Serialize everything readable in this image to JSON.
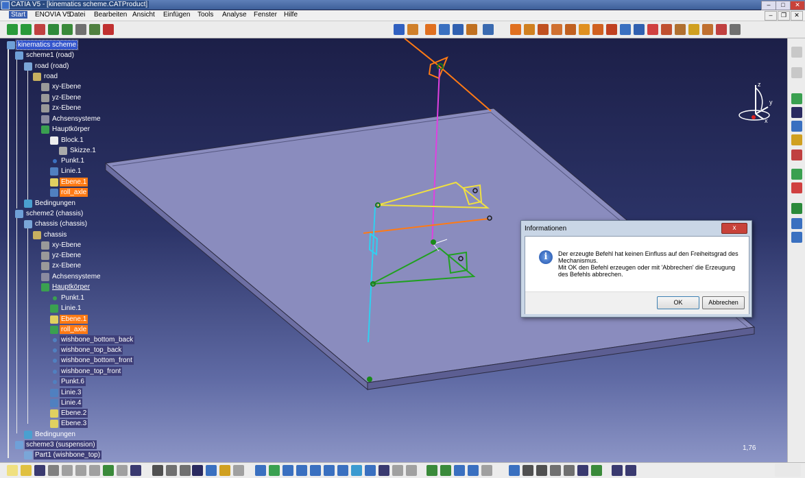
{
  "window": {
    "title": "CATIA V5 - [kinematics scheme.CATProduct]"
  },
  "menu": [
    "Start",
    "ENOVIA V5",
    "Datei",
    "Bearbeiten",
    "Ansicht",
    "Einfügen",
    "Tools",
    "Analyse",
    "Fenster",
    "Hilfe"
  ],
  "tree": [
    {
      "label": "kinematics scheme",
      "style": "sel"
    },
    {
      "label": "scheme1 (road)",
      "style": ""
    },
    {
      "label": "road (road)",
      "style": ""
    },
    {
      "label": "road",
      "style": ""
    },
    {
      "label": "xy-Ebene",
      "style": ""
    },
    {
      "label": "yz-Ebene",
      "style": ""
    },
    {
      "label": "zx-Ebene",
      "style": ""
    },
    {
      "label": "Achsensysteme",
      "style": ""
    },
    {
      "label": "Hauptkörper",
      "style": ""
    },
    {
      "label": "Block.1",
      "style": ""
    },
    {
      "label": "Skizze.1",
      "style": ""
    },
    {
      "label": "Punkt.1",
      "style": ""
    },
    {
      "label": "Linie.1",
      "style": ""
    },
    {
      "label": "Ebene.1",
      "style": "orange"
    },
    {
      "label": "roll_axle",
      "style": "orange"
    },
    {
      "label": "Bedingungen",
      "style": ""
    },
    {
      "label": "scheme2 (chassis)",
      "style": ""
    },
    {
      "label": "chassis (chassis)",
      "style": ""
    },
    {
      "label": "chassis",
      "style": ""
    },
    {
      "label": "xy-Ebene",
      "style": ""
    },
    {
      "label": "yz-Ebene",
      "style": ""
    },
    {
      "label": "zx-Ebene",
      "style": ""
    },
    {
      "label": "Achsensysteme",
      "style": ""
    },
    {
      "label": "Hauptkörper",
      "style": "ul"
    },
    {
      "label": "Punkt.1",
      "style": ""
    },
    {
      "label": "Linie.1",
      "style": ""
    },
    {
      "label": "Ebene.1",
      "style": "orange"
    },
    {
      "label": "roll_axle",
      "style": "orange"
    },
    {
      "label": "wishbone_bottom_back",
      "style": "dark"
    },
    {
      "label": "wishbone_top_back",
      "style": "dark"
    },
    {
      "label": "wishbone_bottom_front",
      "style": "dark"
    },
    {
      "label": "wishbone_top_front",
      "style": "dark"
    },
    {
      "label": "Punkt.6",
      "style": "dark"
    },
    {
      "label": "Linie.3",
      "style": "dark"
    },
    {
      "label": "Linie.4",
      "style": "dark"
    },
    {
      "label": "Ebene.2",
      "style": "dark"
    },
    {
      "label": "Ebene.3",
      "style": "dark"
    },
    {
      "label": "Bedingungen",
      "style": ""
    },
    {
      "label": "scheme3 (suspension)",
      "style": "dark"
    },
    {
      "label": "Part1 (wishbone_top)",
      "style": "dark"
    }
  ],
  "dialog": {
    "title": "Informationen",
    "close": "x",
    "icon": "i",
    "line1": "Der erzeugte Befehl hat keinen Einfluss auf den Freiheitsgrad des Mechanismus.",
    "line2": "Mit OK den Befehl erzeugen oder mit 'Abbrechen' die Erzeugung des Befehls abbrechen.",
    "ok": "OK",
    "cancel": "Abbrechen"
  },
  "viewport": {
    "zoom": "1,76"
  },
  "compass": {
    "z": "z",
    "y": "y",
    "x": "x"
  },
  "colors": {
    "viewport_top": "#1c1f48",
    "viewport_bottom": "#8c95c6",
    "selection": "#3355cc",
    "highlight": "#ff7a14"
  }
}
